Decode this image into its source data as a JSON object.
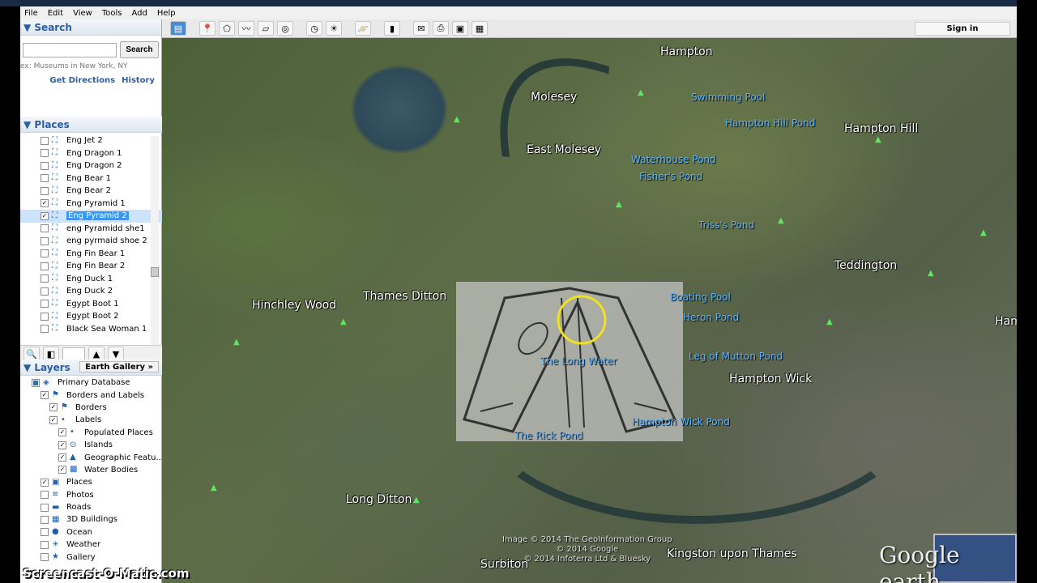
{
  "window": {
    "title": "Google Earth"
  },
  "menu": [
    "File",
    "Edit",
    "View",
    "Tools",
    "Add",
    "Help"
  ],
  "toolbar": {
    "sign_in": "Sign in",
    "icons": [
      "sidebar-icon",
      "placemark-icon",
      "polygon-icon",
      "path-icon",
      "overlay-icon",
      "tour-icon",
      "historical-imagery-icon",
      "sunlight-icon",
      "planets-icon",
      "ruler-icon",
      "email-icon",
      "print-icon",
      "save-image-icon",
      "maps-icon"
    ]
  },
  "search": {
    "header": "▼ Search",
    "placeholder": "",
    "button": "Search",
    "hint": "ex: Museums in New York, NY",
    "get_directions": "Get Directions",
    "history": "History"
  },
  "places": {
    "header": "▼ Places",
    "items": [
      {
        "label": "Eng Jet 2",
        "checked": false
      },
      {
        "label": "Eng Dragon 1",
        "checked": false
      },
      {
        "label": "Eng Dragon 2",
        "checked": false
      },
      {
        "label": "Eng Bear 1",
        "checked": false
      },
      {
        "label": "Eng Bear 2",
        "checked": false
      },
      {
        "label": "Eng Pyramid 1",
        "checked": true
      },
      {
        "label": "Eng Pyramid 2",
        "checked": true,
        "selected": true
      },
      {
        "label": "eng Pyramidd she1",
        "checked": false
      },
      {
        "label": "eng pyrmaid shoe 2",
        "checked": false
      },
      {
        "label": "Eng Fin Bear 1",
        "checked": false
      },
      {
        "label": "Eng Fin Bear 2",
        "checked": false
      },
      {
        "label": "Eng Duck 1",
        "checked": false
      },
      {
        "label": "Eng Duck 2",
        "checked": false
      },
      {
        "label": "Egypt Boot 1",
        "checked": false
      },
      {
        "label": "Egypt Boot 2",
        "checked": false
      },
      {
        "label": "Black Sea Woman 1",
        "checked": false
      }
    ]
  },
  "layers": {
    "header": "▼ Layers",
    "earth_gallery": "Earth Gallery »",
    "items": [
      {
        "label": "Primary Database",
        "indent": 0,
        "checked": "partial",
        "icon": "◈"
      },
      {
        "label": "Borders and Labels",
        "indent": 1,
        "checked": true,
        "icon": "⚑"
      },
      {
        "label": "Borders",
        "indent": 2,
        "checked": true,
        "icon": "⚑"
      },
      {
        "label": "Labels",
        "indent": 2,
        "checked": true,
        "icon": "•"
      },
      {
        "label": "Populated Places",
        "indent": 3,
        "checked": true,
        "icon": "•"
      },
      {
        "label": "Islands",
        "indent": 3,
        "checked": true,
        "icon": "⊙"
      },
      {
        "label": "Geographic Featu...",
        "indent": 3,
        "checked": true,
        "icon": "▲"
      },
      {
        "label": "Water Bodies",
        "indent": 3,
        "checked": true,
        "icon": "▩"
      },
      {
        "label": "Places",
        "indent": 1,
        "checked": true,
        "icon": "▣"
      },
      {
        "label": "Photos",
        "indent": 1,
        "checked": false,
        "icon": "≡"
      },
      {
        "label": "Roads",
        "indent": 1,
        "checked": false,
        "icon": "▬"
      },
      {
        "label": "3D Buildings",
        "indent": 1,
        "checked": false,
        "icon": "▦"
      },
      {
        "label": "Ocean",
        "indent": 1,
        "checked": false,
        "icon": "●"
      },
      {
        "label": "Weather",
        "indent": 1,
        "checked": false,
        "icon": "☀"
      },
      {
        "label": "Gallery",
        "indent": 1,
        "checked": false,
        "icon": "★"
      }
    ]
  },
  "map": {
    "towns": [
      "Hampton",
      "Molesey",
      "East Molesey",
      "Hampton Hill",
      "Teddington",
      "Hinchley Wood",
      "Thames Ditton",
      "Hampton Wick",
      "Long Ditton",
      "Kingston upon Thames",
      "Surbiton",
      "Ham"
    ],
    "water": [
      "Swimming Pool",
      "Hampton Hill Pond",
      "Waterhouse Pond",
      "Fisher's Pond",
      "Triss's Pond",
      "Boating Pool",
      "Heron Pond",
      "Leg of Mutton Pond",
      "The Long Water",
      "Hampton Wick Pond",
      "The Rick Pond"
    ],
    "attribution": [
      "Image © 2014 The GeoInformation Group",
      "© 2014 Google",
      "© 2014 Infoterra Ltd & Bluesky"
    ],
    "logo": "Google earth"
  },
  "watermark": "Screencast-O-Matic.com"
}
